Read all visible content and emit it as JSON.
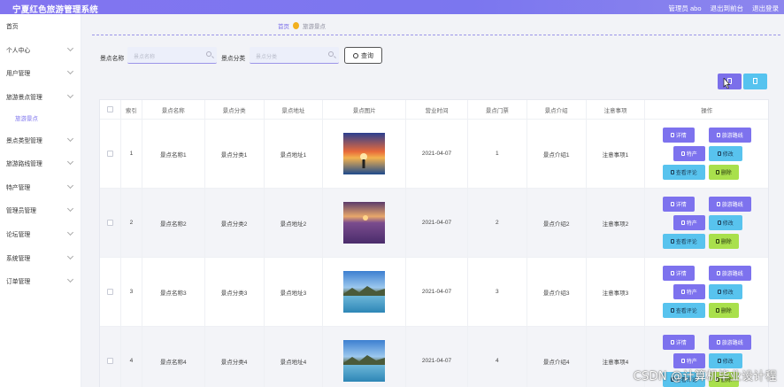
{
  "header": {
    "title": "宁夏红色旅游管理系统",
    "admin_label": "管理员 abo",
    "exit_backend": "退出到前台",
    "logout": "退出登录"
  },
  "sidebar": {
    "items": [
      {
        "label": "首页"
      },
      {
        "label": "个人中心"
      },
      {
        "label": "用户管理"
      },
      {
        "label": "旅游景点管理"
      },
      {
        "label": "旅游景点"
      },
      {
        "label": "景点类型管理"
      },
      {
        "label": "旅游路线管理"
      },
      {
        "label": "特产管理"
      },
      {
        "label": "管理员管理"
      },
      {
        "label": "论坛管理"
      },
      {
        "label": "系统管理"
      },
      {
        "label": "订单管理"
      }
    ]
  },
  "breadcrumb": {
    "home": "首页",
    "current": "旅游景点"
  },
  "search": {
    "name_label": "景点名称",
    "name_placeholder": "景点名称",
    "category_label": "景点分类",
    "category_placeholder": "景点分类",
    "query_label": "查询"
  },
  "table": {
    "headers": [
      "索引",
      "景点名称",
      "景点分类",
      "景点地址",
      "景点图片",
      "营业时间",
      "景点门票",
      "景点介绍",
      "注意事项",
      "操作"
    ],
    "rows": [
      {
        "index": "1",
        "name": "景点名称1",
        "category": "景点分类1",
        "address": "景点地址1",
        "image": "sunset-beach",
        "time": "2021-04-07",
        "ticket": "1",
        "intro": "景点介绍1",
        "note": "注意事项1"
      },
      {
        "index": "2",
        "name": "景点名称2",
        "category": "景点分类2",
        "address": "景点地址2",
        "image": "lavender-field",
        "time": "2021-04-07",
        "ticket": "2",
        "intro": "景点介绍2",
        "note": "注意事项2"
      },
      {
        "index": "3",
        "name": "景点名称3",
        "category": "景点分类3",
        "address": "景点地址3",
        "image": "lake-mountains",
        "time": "2021-04-07",
        "ticket": "3",
        "intro": "景点介绍3",
        "note": "注意事项3"
      },
      {
        "index": "4",
        "name": "景点名称4",
        "category": "景点分类4",
        "address": "景点地址4",
        "image": "lake-mountains",
        "time": "2021-04-07",
        "ticket": "4",
        "intro": "景点介绍4",
        "note": "注意事项4"
      }
    ],
    "actions": {
      "detail": "详情",
      "route": "旅游路线",
      "specialty": "特产",
      "edit": "修改",
      "comments": "查看评论",
      "delete": "删除"
    }
  },
  "watermark": "CSDN @计算机毕业设计程",
  "colors": {
    "accent": "#7b6fea",
    "info": "#56c3ef",
    "success": "#a9e04c"
  }
}
